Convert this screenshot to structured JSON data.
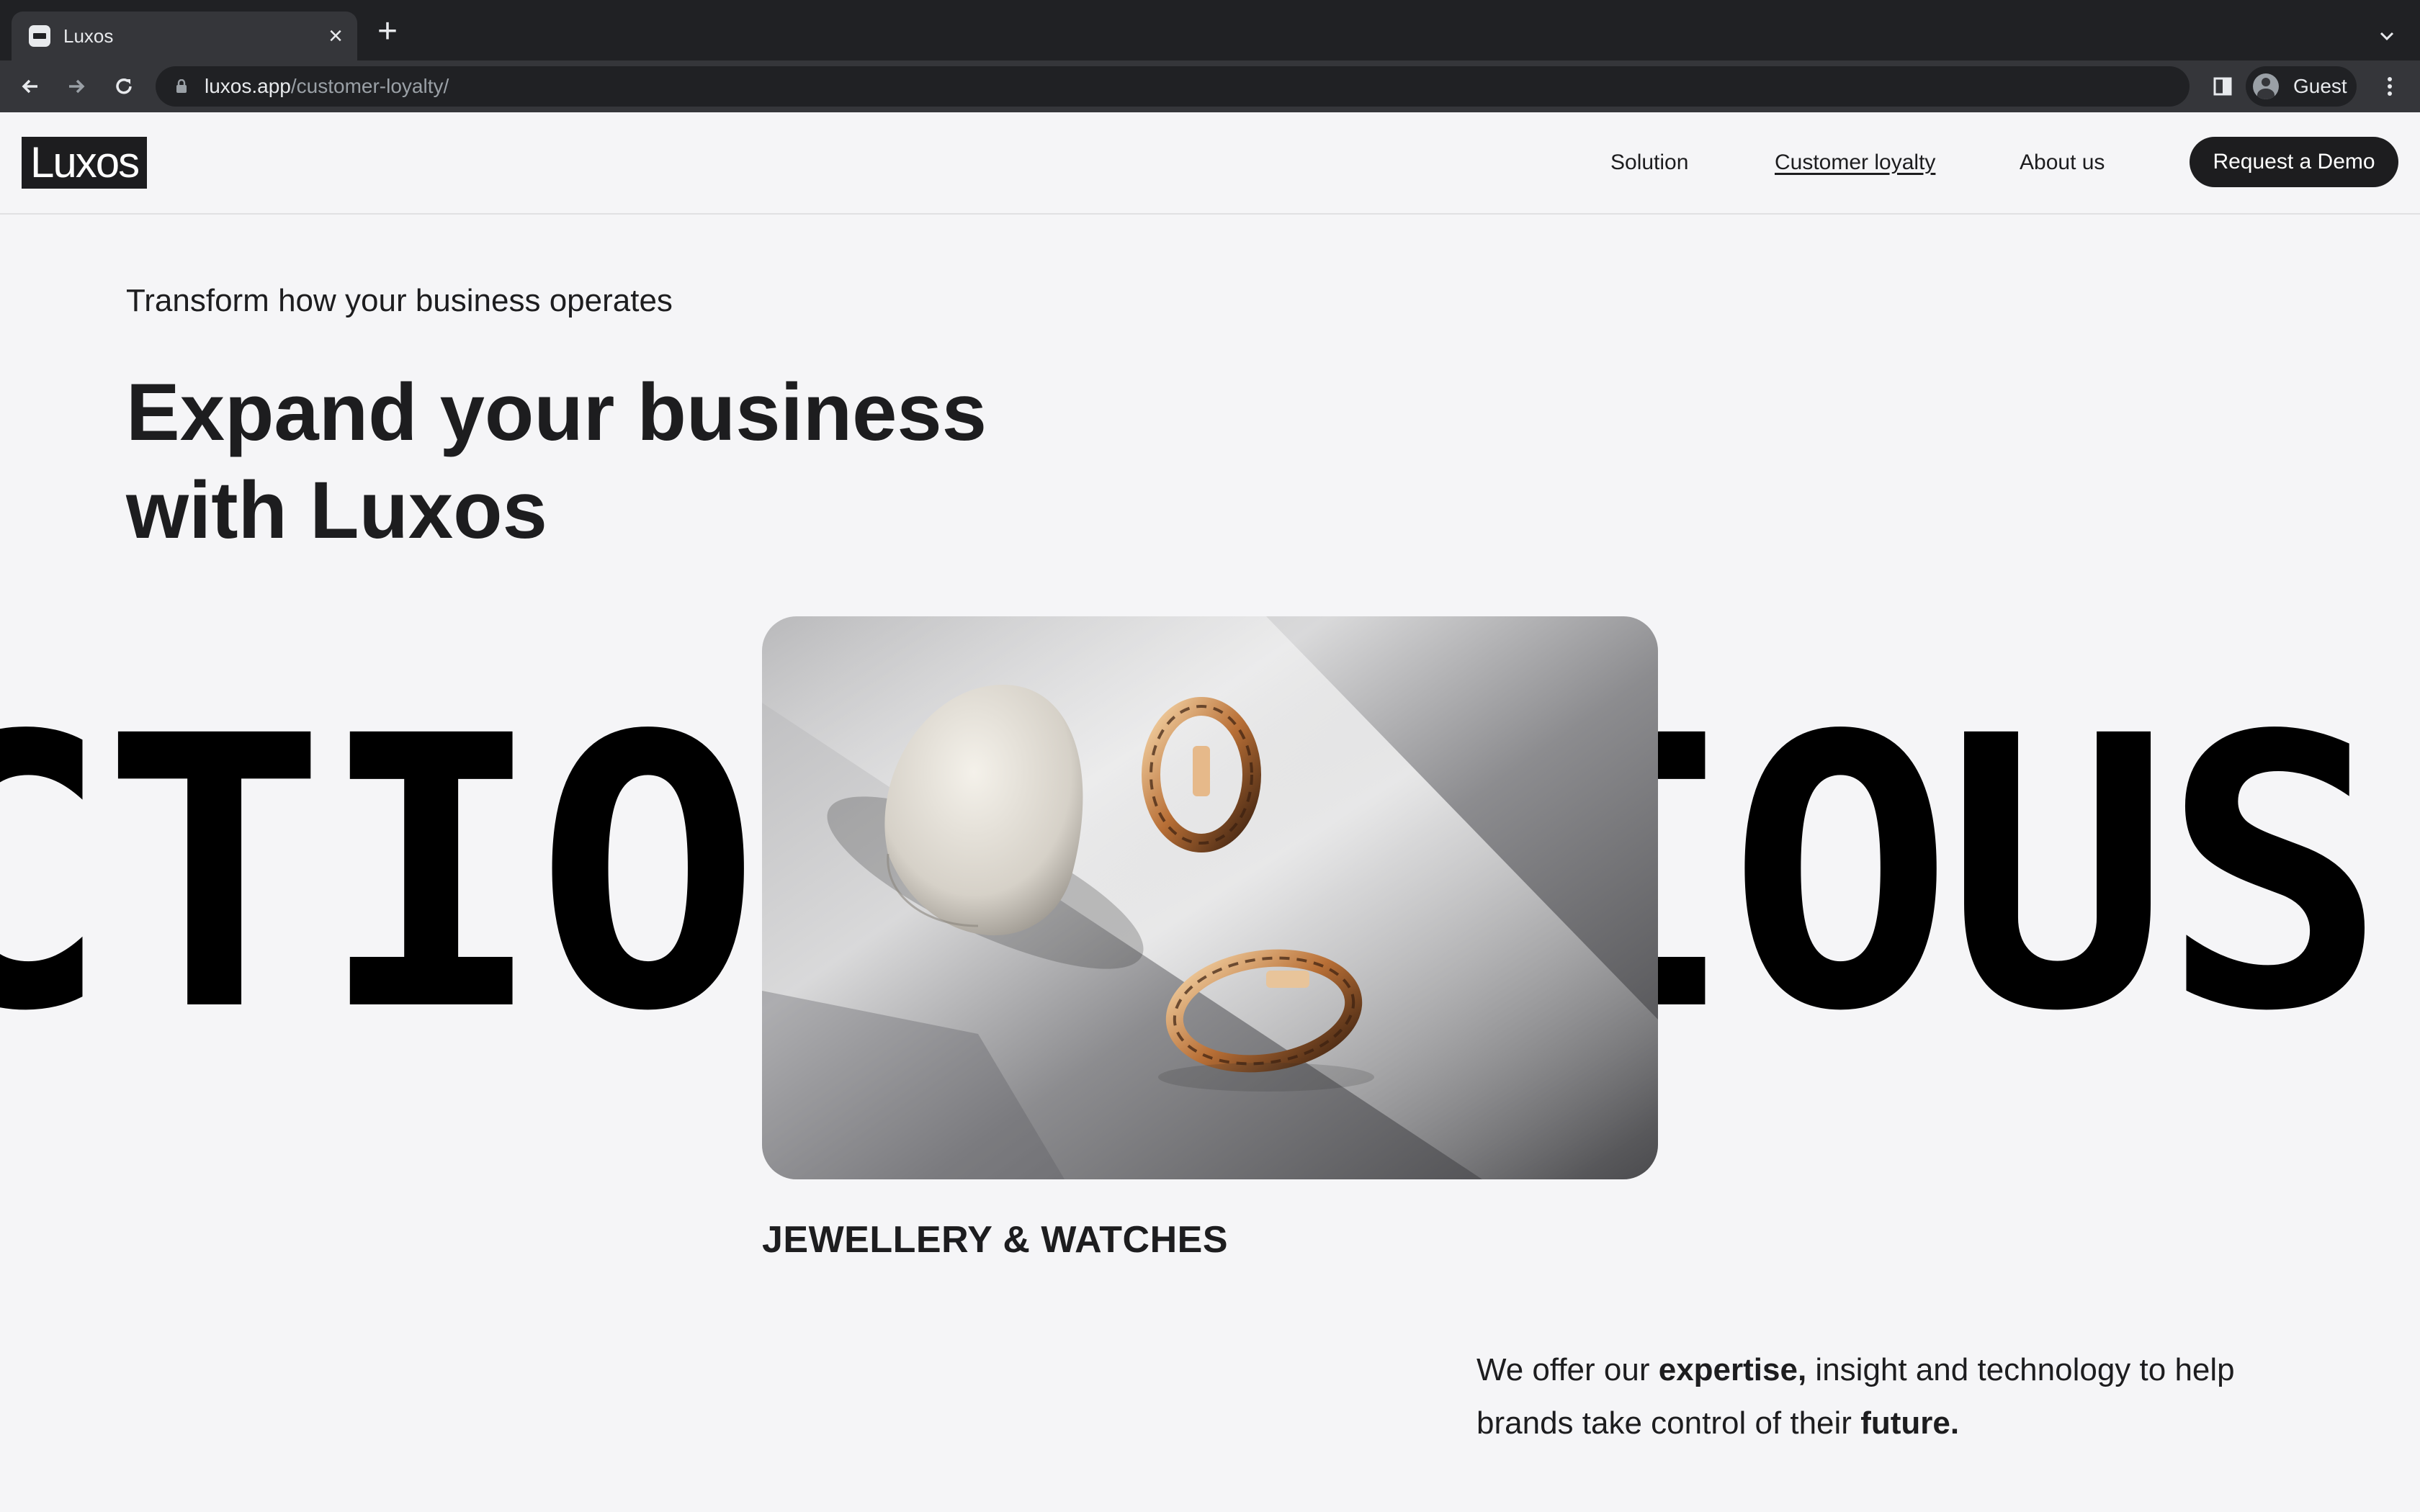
{
  "browser": {
    "tab_title": "Luxos",
    "url_host": "luxos.app",
    "url_path": "/customer-loyalty/",
    "profile_label": "Guest"
  },
  "site": {
    "logo": "Luxos",
    "nav": [
      "Solution",
      "Customer loyalty",
      "About us"
    ],
    "cta": "Request a Demo"
  },
  "hero": {
    "eyebrow": "Transform how your business operates",
    "headline_line1": "Expand your business",
    "headline_line2": "with Luxos",
    "marquee_left": "CTIO",
    "marquee_right": "IOUS",
    "image_alt": "Gold twisted hoop earrings resting on a white stone",
    "category": "JEWELLERY & WATCHES"
  },
  "blurb": {
    "p1": "We offer our ",
    "b1": "expertise,",
    "p2": " insight and technology to help brands take control of their ",
    "b2": "future."
  },
  "colors": {
    "page_bg": "#f5f5f7",
    "text": "#1d1d1f",
    "chrome_dark": "#202124",
    "chrome_mid": "#35363a"
  },
  "icons": [
    "back-icon",
    "forward-icon",
    "reload-icon",
    "lock-icon",
    "side-panel-icon",
    "avatar-icon",
    "more-icon",
    "close-icon",
    "plus-icon",
    "chevron-down-icon"
  ]
}
